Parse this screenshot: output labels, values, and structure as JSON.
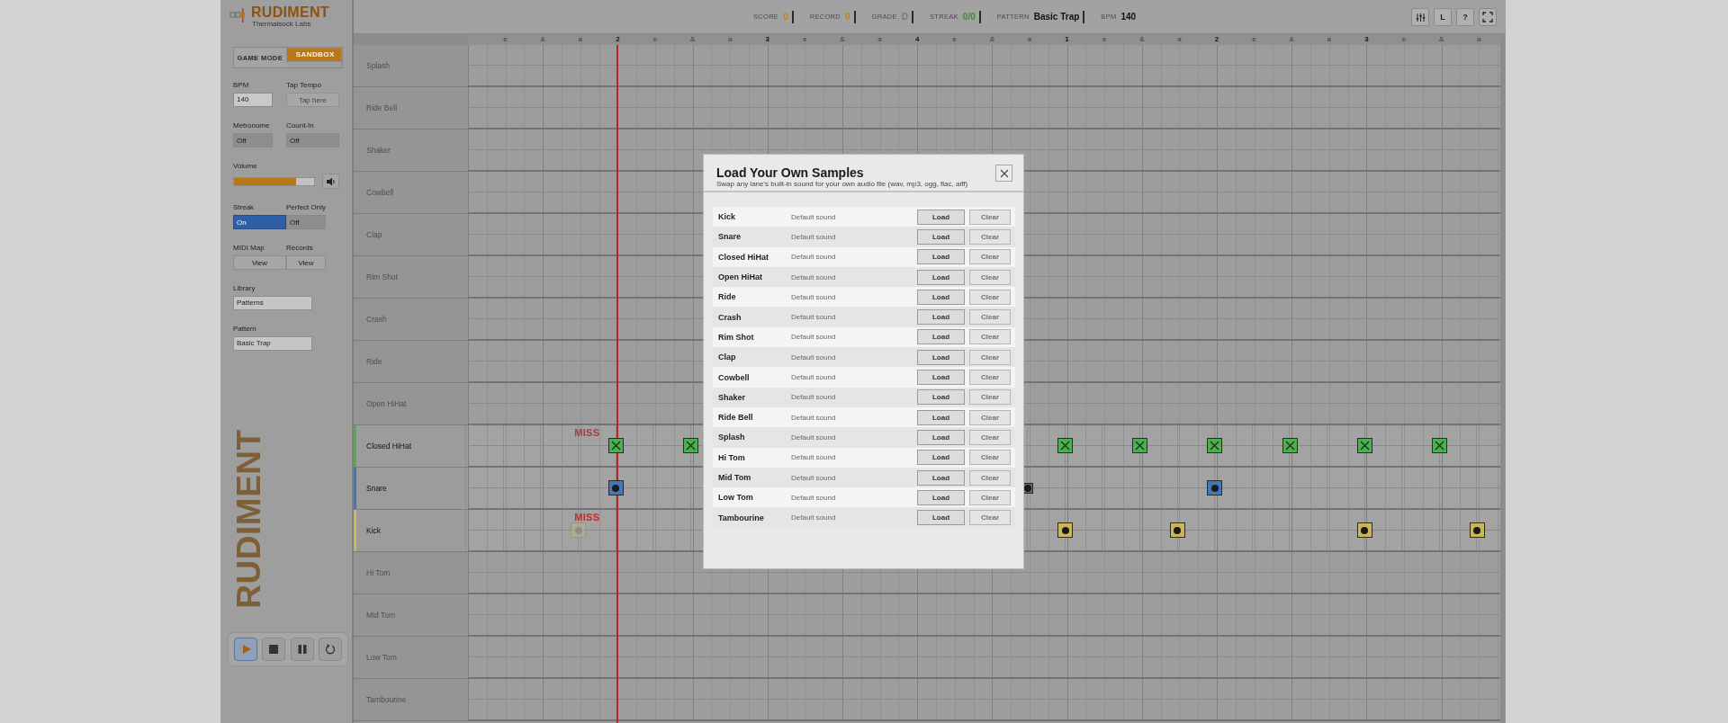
{
  "brand": {
    "name": "RUDIMENT",
    "subtitle": "Thermalsock Labs",
    "watermark": "RUDIMENT"
  },
  "mode_toggle": [
    {
      "label": "GAME MODE",
      "selected": false
    },
    {
      "label": "SANDBOX",
      "selected": true
    }
  ],
  "controls": [
    {
      "label": "BPM",
      "kind": "input",
      "value": "140"
    },
    {
      "label": "Tap Tempo",
      "kind": "tap",
      "placeholder": "Tap here"
    },
    {
      "label": "Metronome",
      "kind": "toggle",
      "value": "Off",
      "on": false
    },
    {
      "label": "Count-In",
      "kind": "toggle",
      "value": "Off",
      "on": false
    },
    {
      "label": "Volume",
      "kind": "slider",
      "level": 0.78
    },
    {
      "label": "Streak",
      "kind": "toggle",
      "value": "On",
      "on": true
    },
    {
      "label": "Perfect Only",
      "kind": "toggle",
      "value": "Off",
      "on": false
    },
    {
      "label": "MIDI Map",
      "kind": "button",
      "value": "View"
    },
    {
      "label": "Records",
      "kind": "button",
      "value": "View"
    },
    {
      "label": "Library",
      "kind": "select",
      "value": "Patterns"
    },
    {
      "label": "Pattern",
      "kind": "select",
      "value": "Basic Trap"
    }
  ],
  "transport": [
    {
      "kind": "play",
      "selected": true
    },
    {
      "kind": "stop",
      "selected": false
    },
    {
      "kind": "pause",
      "selected": false
    },
    {
      "kind": "loop",
      "selected": false
    }
  ],
  "stats": [
    {
      "label": "SCORE",
      "value": "0",
      "color": "#c2801e"
    },
    {
      "label": "RECORD",
      "value": "0",
      "color": "#c2801e"
    },
    {
      "label": "GRADE",
      "value": "D",
      "color": "#7a7a7a"
    },
    {
      "label": "STREAK",
      "value": "0/0",
      "color": "#3e8a2e"
    },
    {
      "label": "PATTERN",
      "value": "Basic Trap",
      "color": "#111111"
    },
    {
      "label": "BPM",
      "value": "140",
      "color": "#111111"
    }
  ],
  "toolbar": [
    {
      "kind": "mixer"
    },
    {
      "kind": "text",
      "label": "L"
    },
    {
      "kind": "text",
      "label": "?"
    },
    {
      "kind": "fullscreen"
    }
  ],
  "ruler": [
    "e",
    "&",
    "a",
    "2",
    "e",
    "&",
    "a",
    "3",
    "e",
    "&",
    "a",
    "4",
    "e",
    "&",
    "a",
    "1",
    "e",
    "&",
    "a",
    "2",
    "e",
    "&",
    "a",
    "3",
    "e",
    "&",
    "a"
  ],
  "playhead": {
    "level": 0.145
  },
  "lanes": [
    {
      "name": "Splash",
      "active": false
    },
    {
      "name": "Ride Bell",
      "active": false
    },
    {
      "name": "Shaker",
      "active": false
    },
    {
      "name": "Cowbell",
      "active": false
    },
    {
      "name": "Clap",
      "active": false
    },
    {
      "name": "Rim Shot",
      "active": false
    },
    {
      "name": "Crash",
      "active": false
    },
    {
      "name": "Ride",
      "active": false
    },
    {
      "name": "Open HiHat",
      "active": false
    },
    {
      "name": "Closed HiHat",
      "active": true,
      "color": "#4caf50",
      "kind": "cross",
      "feedback": {
        "text": "MISS",
        "faded": true
      },
      "steps_left": [
        {
          "hit": false,
          "missed": false,
          "passed": false
        },
        {
          "hit": false,
          "missed": false,
          "passed": false
        },
        {
          "hit": false,
          "missed": false,
          "passed": false
        },
        {
          "hit": false,
          "missed": false,
          "passed": false
        },
        {
          "hit": true,
          "missed": false,
          "passed": false
        },
        {
          "hit": false,
          "missed": false,
          "passed": false
        },
        {
          "hit": true,
          "missed": false,
          "passed": false
        }
      ],
      "steps_right": [
        {
          "hit": false,
          "missed": false,
          "passed": false
        },
        {
          "hit": true,
          "missed": false,
          "passed": false
        },
        {
          "hit": false,
          "missed": false,
          "passed": false
        },
        {
          "hit": true,
          "missed": false,
          "passed": false
        },
        {
          "hit": false,
          "missed": false,
          "passed": false
        },
        {
          "hit": true,
          "missed": false,
          "passed": false
        },
        {
          "hit": false,
          "missed": false,
          "passed": false
        },
        {
          "hit": true,
          "missed": false,
          "passed": false
        },
        {
          "hit": false,
          "missed": false,
          "passed": false
        },
        {
          "hit": true,
          "missed": false,
          "passed": false
        },
        {
          "hit": false,
          "missed": false,
          "passed": false
        },
        {
          "hit": true,
          "missed": false,
          "passed": false
        },
        {
          "hit": false,
          "missed": false,
          "passed": false
        }
      ]
    },
    {
      "name": "Snare",
      "active": true,
      "color": "#3f79b8",
      "kind": "dot",
      "steps_left": [
        {
          "hit": false,
          "missed": false,
          "passed": false
        },
        {
          "hit": false,
          "missed": false,
          "passed": false
        },
        {
          "hit": false,
          "missed": false,
          "passed": false
        },
        {
          "hit": false,
          "missed": false,
          "passed": false
        },
        {
          "hit": true,
          "missed": false,
          "passed": false
        },
        {
          "hit": false,
          "missed": false,
          "passed": false
        },
        {
          "hit": false,
          "missed": false,
          "passed": false
        }
      ],
      "steps_right": [
        {
          "hit": true,
          "missed": false,
          "passed": true
        },
        {
          "hit": false,
          "missed": false,
          "passed": false
        },
        {
          "hit": false,
          "missed": false,
          "passed": false
        },
        {
          "hit": false,
          "missed": false,
          "passed": false
        },
        {
          "hit": false,
          "missed": false,
          "passed": false
        },
        {
          "hit": true,
          "missed": false,
          "passed": false
        },
        {
          "hit": false,
          "missed": false,
          "passed": false
        },
        {
          "hit": false,
          "missed": false,
          "passed": false
        },
        {
          "hit": false,
          "missed": false,
          "passed": false
        },
        {
          "hit": false,
          "missed": false,
          "passed": false
        },
        {
          "hit": false,
          "missed": false,
          "passed": false
        },
        {
          "hit": false,
          "missed": false,
          "passed": false
        },
        {
          "hit": false,
          "missed": false,
          "passed": false
        }
      ]
    },
    {
      "name": "Kick",
      "active": true,
      "color": "#c9b75a",
      "kind": "dot",
      "feedback": {
        "text": "MISS",
        "faded": false
      },
      "steps_left": [
        {
          "hit": false,
          "missed": false,
          "passed": false
        },
        {
          "hit": false,
          "missed": false,
          "passed": false
        },
        {
          "hit": false,
          "missed": false,
          "passed": false
        },
        {
          "hit": true,
          "missed": true,
          "passed": false
        },
        {
          "hit": false,
          "missed": false,
          "passed": false
        },
        {
          "hit": false,
          "missed": false,
          "passed": false
        },
        {
          "hit": false,
          "missed": false,
          "passed": false
        }
      ],
      "steps_right": [
        {
          "hit": false,
          "missed": false,
          "passed": false
        },
        {
          "hit": true,
          "missed": false,
          "passed": false
        },
        {
          "hit": false,
          "missed": false,
          "passed": false
        },
        {
          "hit": false,
          "missed": false,
          "passed": false
        },
        {
          "hit": true,
          "missed": false,
          "passed": false
        },
        {
          "hit": false,
          "missed": false,
          "passed": false
        },
        {
          "hit": false,
          "missed": false,
          "passed": false
        },
        {
          "hit": false,
          "missed": false,
          "passed": false
        },
        {
          "hit": false,
          "missed": false,
          "passed": false
        },
        {
          "hit": true,
          "missed": false,
          "passed": false
        },
        {
          "hit": false,
          "missed": false,
          "passed": false
        },
        {
          "hit": false,
          "missed": false,
          "passed": false
        },
        {
          "hit": true,
          "missed": false,
          "passed": false
        }
      ]
    },
    {
      "name": "Hi Tom",
      "active": false
    },
    {
      "name": "Mid Tom",
      "active": false
    },
    {
      "name": "Low Tom",
      "active": false
    },
    {
      "name": "Tambourine",
      "active": false
    }
  ],
  "modal": {
    "title": "Load Your Own Samples",
    "subtitle": "Swap any lane's built-in sound for your own audio file (wav, mp3, ogg, flac, aiff)",
    "rows": [
      {
        "name": "Kick",
        "status": "Default sound",
        "load": "Load",
        "clear": "Clear",
        "clear_disabled": true
      },
      {
        "name": "Snare",
        "status": "Default sound",
        "load": "Load",
        "clear": "Clear",
        "clear_disabled": true
      },
      {
        "name": "Closed HiHat",
        "status": "Default sound",
        "load": "Load",
        "clear": "Clear",
        "clear_disabled": true
      },
      {
        "name": "Open HiHat",
        "status": "Default sound",
        "load": "Load",
        "clear": "Clear",
        "clear_disabled": true
      },
      {
        "name": "Ride",
        "status": "Default sound",
        "load": "Load",
        "clear": "Clear",
        "clear_disabled": true
      },
      {
        "name": "Crash",
        "status": "Default sound",
        "load": "Load",
        "clear": "Clear",
        "clear_disabled": true
      },
      {
        "name": "Rim Shot",
        "status": "Default sound",
        "load": "Load",
        "clear": "Clear",
        "clear_disabled": true
      },
      {
        "name": "Clap",
        "status": "Default sound",
        "load": "Load",
        "clear": "Clear",
        "clear_disabled": true
      },
      {
        "name": "Cowbell",
        "status": "Default sound",
        "load": "Load",
        "clear": "Clear",
        "clear_disabled": true
      },
      {
        "name": "Shaker",
        "status": "Default sound",
        "load": "Load",
        "clear": "Clear",
        "clear_disabled": true
      },
      {
        "name": "Ride Bell",
        "status": "Default sound",
        "load": "Load",
        "clear": "Clear",
        "clear_disabled": true
      },
      {
        "name": "Splash",
        "status": "Default sound",
        "load": "Load",
        "clear": "Clear",
        "clear_disabled": true
      },
      {
        "name": "Hi Tom",
        "status": "Default sound",
        "load": "Load",
        "clear": "Clear",
        "clear_disabled": true
      },
      {
        "name": "Mid Tom",
        "status": "Default sound",
        "load": "Load",
        "clear": "Clear",
        "clear_disabled": true
      },
      {
        "name": "Low Tom",
        "status": "Default sound",
        "load": "Load",
        "clear": "Clear",
        "clear_disabled": true
      },
      {
        "name": "Tambourine",
        "status": "Default sound",
        "load": "Load",
        "clear": "Clear",
        "clear_disabled": true
      }
    ]
  }
}
